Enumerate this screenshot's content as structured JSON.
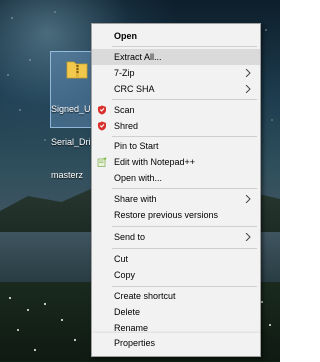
{
  "desktop": {
    "icon": {
      "name": "Signed_USB_Serial_Driver_masterzone",
      "label_lines": [
        "Signed_U",
        "Serial_Dri",
        "masterz"
      ]
    }
  },
  "context_menu": {
    "items": [
      {
        "label": "Open",
        "bold": true
      },
      {
        "label": "Extract All...",
        "hover": true
      },
      {
        "label": "7-Zip",
        "submenu": true
      },
      {
        "label": "CRC SHA",
        "submenu": true
      },
      {
        "label": "Scan",
        "icon": "shield-icon"
      },
      {
        "label": "Shred",
        "icon": "shield-icon"
      },
      {
        "label": "Pin to Start"
      },
      {
        "label": "Edit with Notepad++",
        "icon": "notepadpp-icon"
      },
      {
        "label": "Open with..."
      },
      {
        "label": "Share with",
        "submenu": true
      },
      {
        "label": "Restore previous versions"
      },
      {
        "label": "Send to",
        "submenu": true
      },
      {
        "label": "Cut"
      },
      {
        "label": "Copy"
      },
      {
        "label": "Create shortcut"
      },
      {
        "label": "Delete"
      },
      {
        "label": "Rename"
      },
      {
        "label": "Properties"
      }
    ]
  },
  "colors": {
    "menu_background": "#f2f2f2",
    "menu_hover": "#dadada",
    "shield_red": "#d9302c",
    "selection_fill": "#78aadc"
  }
}
